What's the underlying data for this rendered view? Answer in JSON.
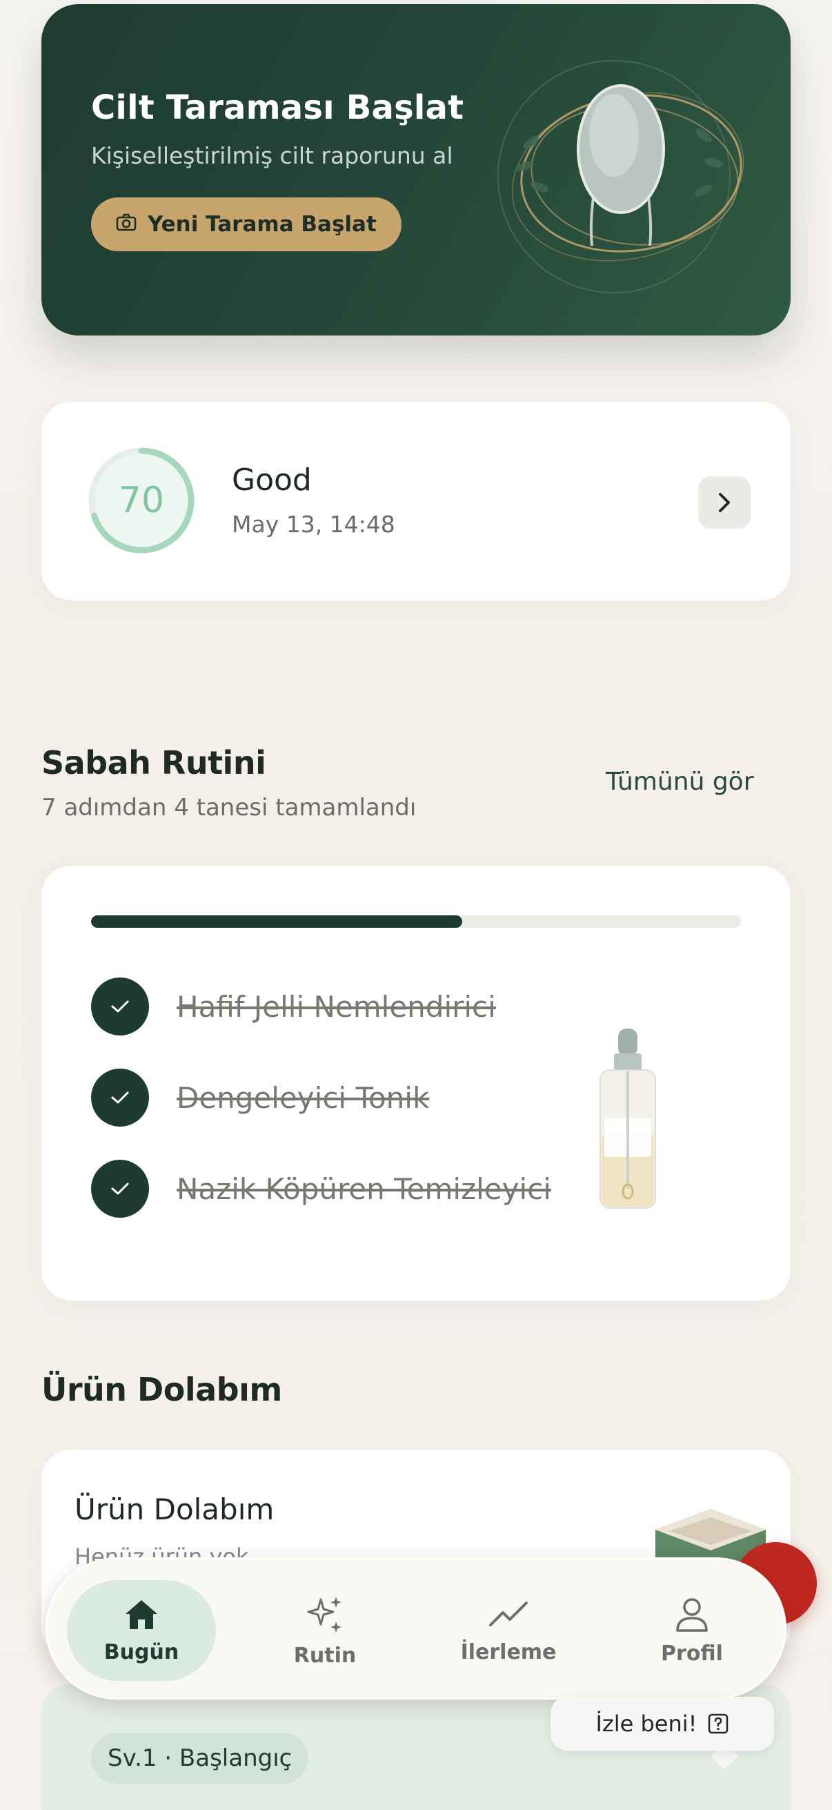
{
  "hero": {
    "title": "Cilt Taraması Başlat",
    "subtitle": "Kişiselleştirilmiş cilt raporunu al",
    "button_label": "Yeni Tarama Başlat",
    "button_icon": "camera-icon",
    "accent_color": "#c9a56e",
    "background_color": "#1e3b30"
  },
  "score": {
    "value": "70",
    "progress_fraction": 0.7,
    "label": "Good",
    "date": "May 13, 14:48",
    "ring_color": "#a6d6bb"
  },
  "routine": {
    "title": "Sabah Rutini",
    "subtitle": "7 adımdan 4 tanesi tamamlandı",
    "see_all": "Tümünü gör",
    "progress_fraction": 0.5714,
    "steps": [
      {
        "label": "Hafif Jelli Nemlendirici",
        "done": true
      },
      {
        "label": "Dengeleyici Tonik",
        "done": true
      },
      {
        "label": "Nazik Köpüren Temizleyici",
        "done": true
      }
    ]
  },
  "shelf": {
    "section_title": "Ürün Dolabım",
    "card_title": "Ürün Dolabım",
    "card_subtitle": "Henüz ürün yok"
  },
  "level": {
    "chip": "Sv.1 · Başlangıç"
  },
  "nav": {
    "items": [
      {
        "label": "Bugün",
        "icon": "home-icon",
        "active": true
      },
      {
        "label": "Rutin",
        "icon": "sparkles-icon",
        "active": false
      },
      {
        "label": "İlerleme",
        "icon": "trend-icon",
        "active": false
      },
      {
        "label": "Profil",
        "icon": "user-icon",
        "active": false
      }
    ]
  },
  "tooltip": {
    "text": "İzle beni!",
    "icon": "question-icon"
  }
}
